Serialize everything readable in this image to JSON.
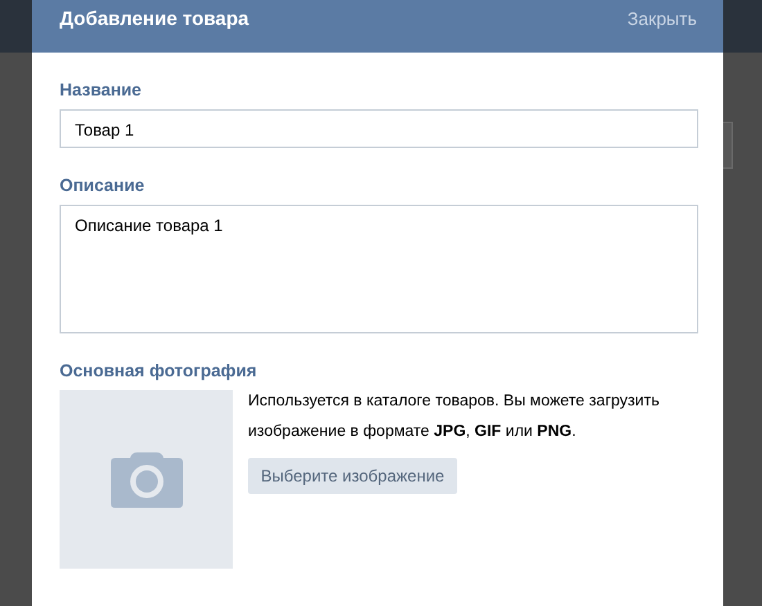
{
  "dialog": {
    "title": "Добавление товара",
    "close": "Закрыть",
    "fields": [
      {
        "kind": "input",
        "label": "Название",
        "value": "Товар 1"
      },
      {
        "kind": "textarea",
        "label": "Описание",
        "value": "Описание товара 1"
      }
    ],
    "photo": {
      "label": "Основная фотография",
      "hint": "Используется в каталоге товаров. Вы можете загрузить изображение в формате **JPG**, **GIF** или **PNG**.",
      "button": "Выберите изображение"
    }
  }
}
